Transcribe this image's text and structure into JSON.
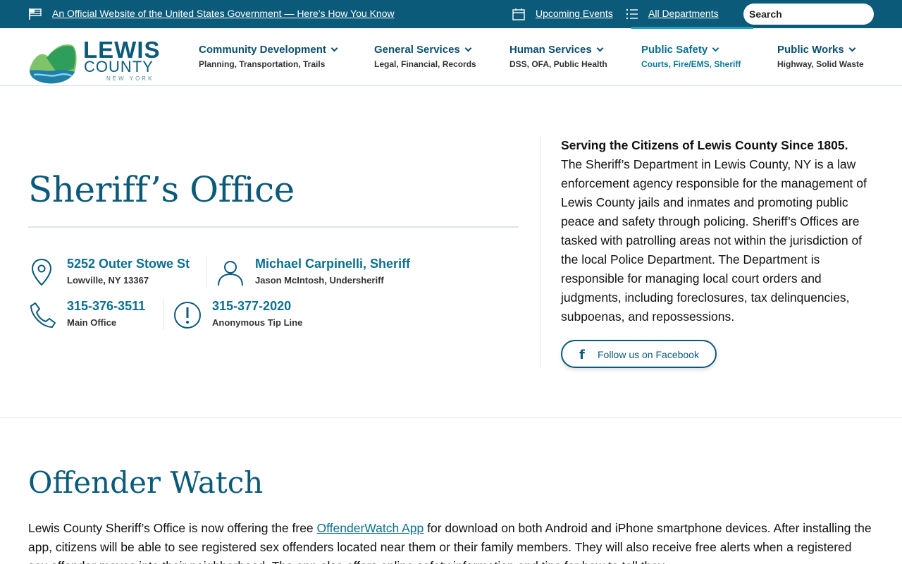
{
  "gov_bar": {
    "official_link": "An Official Website of the United States Government — Here’s How You Know",
    "events_link": "Upcoming Events",
    "departments_link": "All Departments",
    "search_placeholder": "Search"
  },
  "logo": {
    "line1": "LEWIS",
    "line2": "COUNTY",
    "line3": "NEW YORK"
  },
  "nav": [
    {
      "title": "Community Development",
      "sub": "Planning, Transportation, Trails"
    },
    {
      "title": "General Services",
      "sub": "Legal, Financial, Records"
    },
    {
      "title": "Human Services",
      "sub": "DSS, OFA, Public Health"
    },
    {
      "title": "Public Safety",
      "sub": "Courts, Fire/EMS, Sheriff"
    },
    {
      "title": "Public Works",
      "sub": "Highway, Solid Waste"
    }
  ],
  "hero": {
    "title": "Sheriff’s Office"
  },
  "contacts": {
    "address_main": "5252 Outer Stowe St",
    "address_sub": "Lowville, NY 13367",
    "sheriff_main": "Michael Carpinelli, Sheriff",
    "sheriff_sub": "Jason McIntosh, Undersheriff",
    "phone_main": "315-376-3511",
    "phone_sub": "Main Office",
    "tip_main": "315-377-2020",
    "tip_sub": "Anonymous Tip Line"
  },
  "about": {
    "lead": "Serving the Citizens of Lewis County Since 1805.",
    "body": "The Sheriff’s Department in Lewis County, NY is a law enforcement agency responsible for the management of Lewis County jails and inmates and promoting public peace and safety through policing. Sheriff’s Offices are tasked with patrolling areas not within the jurisdiction of the local Police Department. The Department is responsible for managing local court orders and judgments, including foreclosures, tax delinquencies, subpoenas, and repossessions.",
    "facebook_button": "Follow us on Facebook"
  },
  "offender_watch": {
    "title": "Offender Watch",
    "text_before": "Lewis County Sheriff’s Office is now offering the free ",
    "link": "OffenderWatch App",
    "text_after": " for download on both Android and iPhone smartphone devices. After installing the app, citizens will be able to see registered sex offenders located near them or their family members. They will also receive free alerts when a registered sex offender moves into their neighborhood. The app also offers online safety information and tips for how to tell they"
  }
}
